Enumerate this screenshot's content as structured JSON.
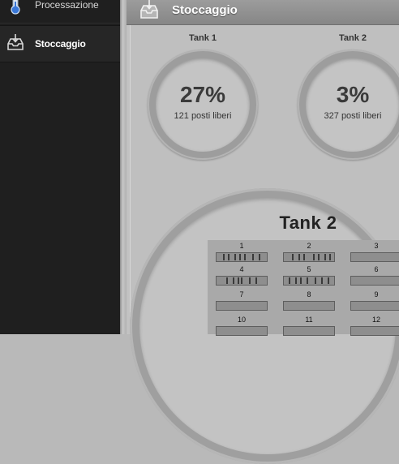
{
  "sidebar": {
    "items": [
      {
        "label": "Processazione",
        "icon": "thermometer-icon"
      },
      {
        "label": "Stoccaggio",
        "icon": "inbox-tray-icon",
        "active": true
      }
    ]
  },
  "header": {
    "title": "Stoccaggio",
    "icon": "inbox-tray-icon"
  },
  "tanks": [
    {
      "label": "Tank 1",
      "percent": "27%",
      "free": "121 posti liberi"
    },
    {
      "label": "Tank 2",
      "percent": "3%",
      "free": "327 posti liberi"
    }
  ],
  "detail": {
    "title": "Tank 2",
    "slots": [
      {
        "number": "1",
        "occupied": true
      },
      {
        "number": "2",
        "occupied": true
      },
      {
        "number": "3",
        "occupied": false
      },
      {
        "number": "4",
        "occupied": true
      },
      {
        "number": "5",
        "occupied": true
      },
      {
        "number": "6",
        "occupied": false
      },
      {
        "number": "7",
        "occupied": false
      },
      {
        "number": "8",
        "occupied": false
      },
      {
        "number": "9",
        "occupied": false
      },
      {
        "number": "10",
        "occupied": false
      },
      {
        "number": "11",
        "occupied": false
      },
      {
        "number": "12",
        "occupied": false
      }
    ]
  }
}
